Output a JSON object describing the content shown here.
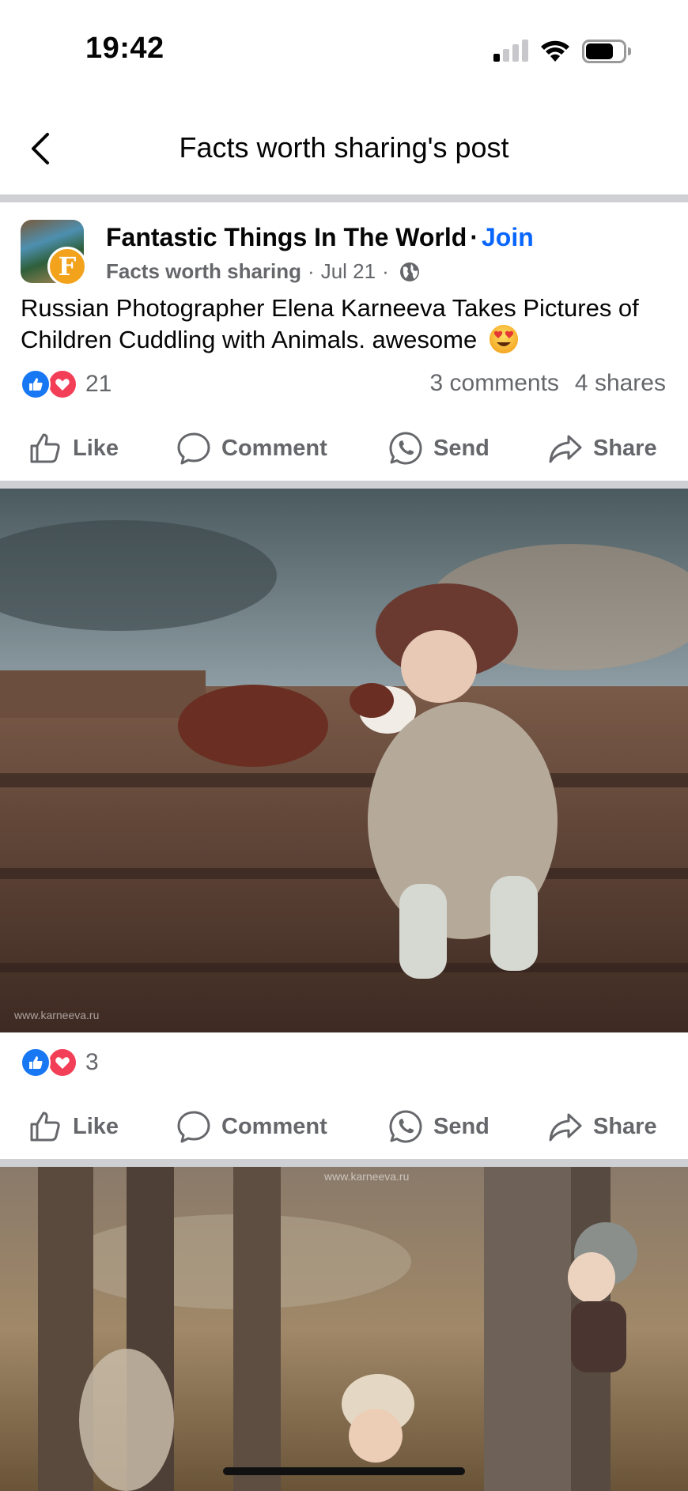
{
  "status_bar": {
    "time": "19:42"
  },
  "header": {
    "title": "Facts worth sharing's post"
  },
  "post": {
    "group_name": "Fantastic Things In The World",
    "separator": "·",
    "join_label": "Join",
    "avatar_letter": "F",
    "author": "Facts worth sharing",
    "date": "Jul 21",
    "caption": "Russian Photographer Elena Karneeva Takes Pictures of Children Cuddling with Animals. awesome",
    "reaction_count": "21",
    "comments": "3 comments",
    "shares": "4 shares"
  },
  "actions": {
    "like": "Like",
    "comment": "Comment",
    "send": "Send",
    "share": "Share"
  },
  "photo1": {
    "watermark": "www.karneeva.ru",
    "reaction_count": "3"
  },
  "photo2": {
    "watermark": "www.karneeva.ru"
  },
  "colors": {
    "accent": "#0866ff",
    "like": "#1877f2",
    "love": "#f33e58",
    "divider": "#ced0d4",
    "secondary_text": "#65676b"
  }
}
